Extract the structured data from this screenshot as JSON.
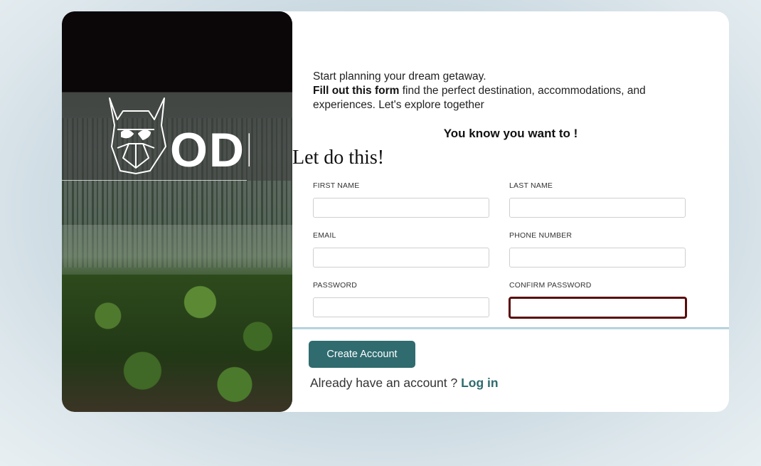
{
  "hero": {
    "logo_text": "ODIN",
    "logo_icon": "viking-helmet-icon"
  },
  "intro": {
    "line1": "Start planning your dream getaway.",
    "bold_lead": "Fill out this form",
    "line2_rest": " find the perfect destination, accommodations, and experiences. Let's explore together"
  },
  "tagline": "You know you want to !",
  "heading": "Let do this!",
  "form": {
    "first_name_label": "FIRST NAME",
    "last_name_label": "LAST NAME",
    "email_label": "EMAIL",
    "phone_label": "PHONE NUMBER",
    "password_label": "PASSWORD",
    "confirm_password_label": "CONFIRM PASSWORD",
    "first_name_value": "",
    "last_name_value": "",
    "email_value": "",
    "phone_value": "",
    "password_value": "",
    "confirm_password_value": ""
  },
  "actions": {
    "create_account_label": "Create Account",
    "login_prompt": "Already have an account ? ",
    "login_link": "Log in"
  },
  "colors": {
    "accent": "#2f6b6f",
    "invalid_border": "#5a0b0b"
  }
}
